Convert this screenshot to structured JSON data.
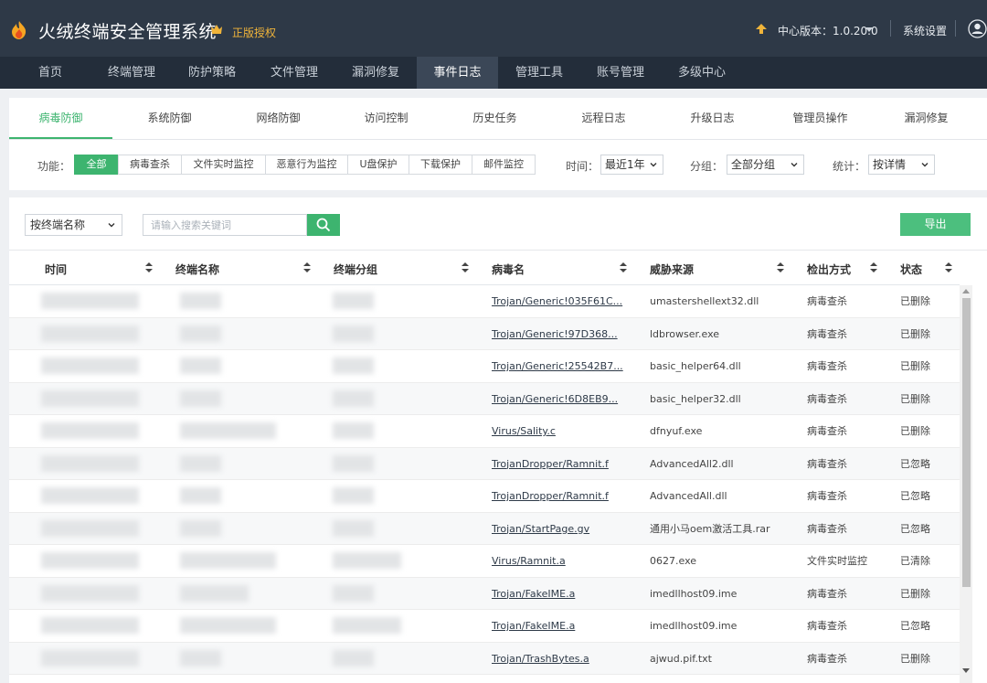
{
  "header": {
    "title": "火绒终端安全管理系统",
    "license_label": "正版授权",
    "version_label": "中心版本：1.0.20.0",
    "settings_label": "系统设置",
    "colors": {
      "header_bg": "#2e3947",
      "nav_bg": "#232d3a",
      "accent": "#3db46f",
      "license": "#f0b43a"
    }
  },
  "nav": {
    "items": [
      {
        "label": "首页"
      },
      {
        "label": "终端管理"
      },
      {
        "label": "防护策略"
      },
      {
        "label": "文件管理"
      },
      {
        "label": "漏洞修复"
      },
      {
        "label": "事件日志",
        "active": true
      },
      {
        "label": "管理工具"
      },
      {
        "label": "账号管理"
      },
      {
        "label": "多级中心"
      }
    ]
  },
  "subtabs": {
    "items": [
      {
        "label": "病毒防御",
        "active": true
      },
      {
        "label": "系统防御"
      },
      {
        "label": "网络防御"
      },
      {
        "label": "访问控制"
      },
      {
        "label": "历史任务"
      },
      {
        "label": "远程日志"
      },
      {
        "label": "升级日志"
      },
      {
        "label": "管理员操作"
      },
      {
        "label": "漏洞修复"
      }
    ]
  },
  "filters": {
    "function_label": "功能：",
    "function_options": [
      {
        "label": "全部",
        "active": true
      },
      {
        "label": "病毒查杀"
      },
      {
        "label": "文件实时监控"
      },
      {
        "label": "恶意行为监控"
      },
      {
        "label": "U盘保护"
      },
      {
        "label": "下载保护"
      },
      {
        "label": "邮件监控"
      }
    ],
    "time_label": "时间：",
    "time_value": "最近1年",
    "group_label": "分组：",
    "group_value": "全部分组",
    "stat_label": "统计：",
    "stat_value": "按详情"
  },
  "toolbar": {
    "search_by": "按终端名称",
    "search_placeholder": "请输入搜索关键词",
    "export_label": "导出"
  },
  "table": {
    "columns": [
      "时间",
      "终端名称",
      "终端分组",
      "病毒名",
      "威胁来源",
      "检出方式",
      "状态"
    ],
    "rows": [
      {
        "virus": "Trojan/Generic!035F61C...",
        "source": "umastershellext32.dll",
        "method": "病毒查杀",
        "status": "已删除"
      },
      {
        "virus": "Trojan/Generic!97D368...",
        "source": "ldbrowser.exe",
        "method": "病毒查杀",
        "status": "已删除"
      },
      {
        "virus": "Trojan/Generic!25542B7...",
        "source": "basic_helper64.dll",
        "method": "病毒查杀",
        "status": "已删除"
      },
      {
        "virus": "Trojan/Generic!6D8EB9...",
        "source": "basic_helper32.dll",
        "method": "病毒查杀",
        "status": "已删除"
      },
      {
        "virus": "Virus/Sality.c",
        "source": "dfnyuf.exe",
        "method": "病毒查杀",
        "status": "已删除"
      },
      {
        "virus": "TrojanDropper/Ramnit.f",
        "source": "AdvancedAll2.dll",
        "method": "病毒查杀",
        "status": "已忽略"
      },
      {
        "virus": "TrojanDropper/Ramnit.f",
        "source": "AdvancedAll.dll",
        "method": "病毒查杀",
        "status": "已忽略"
      },
      {
        "virus": "Trojan/StartPage.gv",
        "source": "通用小马oem激活工具.rar",
        "method": "病毒查杀",
        "status": "已忽略"
      },
      {
        "virus": "Virus/Ramnit.a",
        "source": "0627.exe",
        "method": "文件实时监控",
        "status": "已清除"
      },
      {
        "virus": "Trojan/FakeIME.a",
        "source": "imedllhost09.ime",
        "method": "病毒查杀",
        "status": "已删除"
      },
      {
        "virus": "Trojan/FakeIME.a",
        "source": "imedllhost09.ime",
        "method": "病毒查杀",
        "status": "已忽略"
      },
      {
        "virus": "Trojan/TrashBytes.a",
        "source": "ajwud.pif.txt",
        "method": "病毒查杀",
        "status": "已删除"
      }
    ]
  }
}
